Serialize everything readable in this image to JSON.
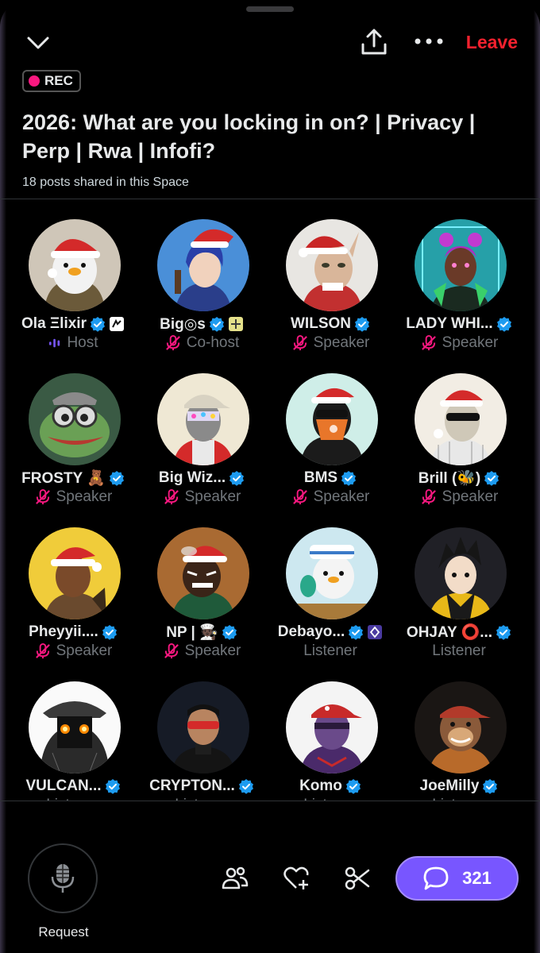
{
  "header": {
    "leave_label": "Leave",
    "rec_label": "REC",
    "title": "2026: What are you locking in on? | Privacy | Perp | Rwa | Infofi?",
    "posts_shared": "18 posts shared in this Space"
  },
  "participants": [
    {
      "name": "Ola Ξlixir",
      "role": "Host"
    },
    {
      "name": "Big◎s",
      "role": "Co-host"
    },
    {
      "name": "WILSON",
      "role": "Speaker"
    },
    {
      "name": "LADY WHI...",
      "role": "Speaker"
    },
    {
      "name": "FROSTY 🧸",
      "role": "Speaker"
    },
    {
      "name": "Big Wiz...",
      "role": "Speaker"
    },
    {
      "name": "BMS",
      "role": "Speaker"
    },
    {
      "name": "Brill (🐝)",
      "role": "Speaker"
    },
    {
      "name": "Pheyyii....",
      "role": "Speaker"
    },
    {
      "name": "NP | 🧑🏿‍🍳",
      "role": "Speaker"
    },
    {
      "name": "Debayo...",
      "role": "Listener"
    },
    {
      "name": "OHJAY ⭕...",
      "role": "Listener"
    },
    {
      "name": "VULCAN...",
      "role": "Listener"
    },
    {
      "name": "CRYPTON...",
      "role": "Listener"
    },
    {
      "name": "Komo",
      "role": "Listener"
    },
    {
      "name": "JoeMilly",
      "role": "Listener"
    }
  ],
  "bottom": {
    "request_label": "Request",
    "comments_count": "321"
  },
  "colors": {
    "accent": "#7856ff",
    "verified": "#1d9bf0",
    "leave": "#f4212e",
    "rec_dot": "#f91880",
    "muted_mic": "#f91880"
  }
}
